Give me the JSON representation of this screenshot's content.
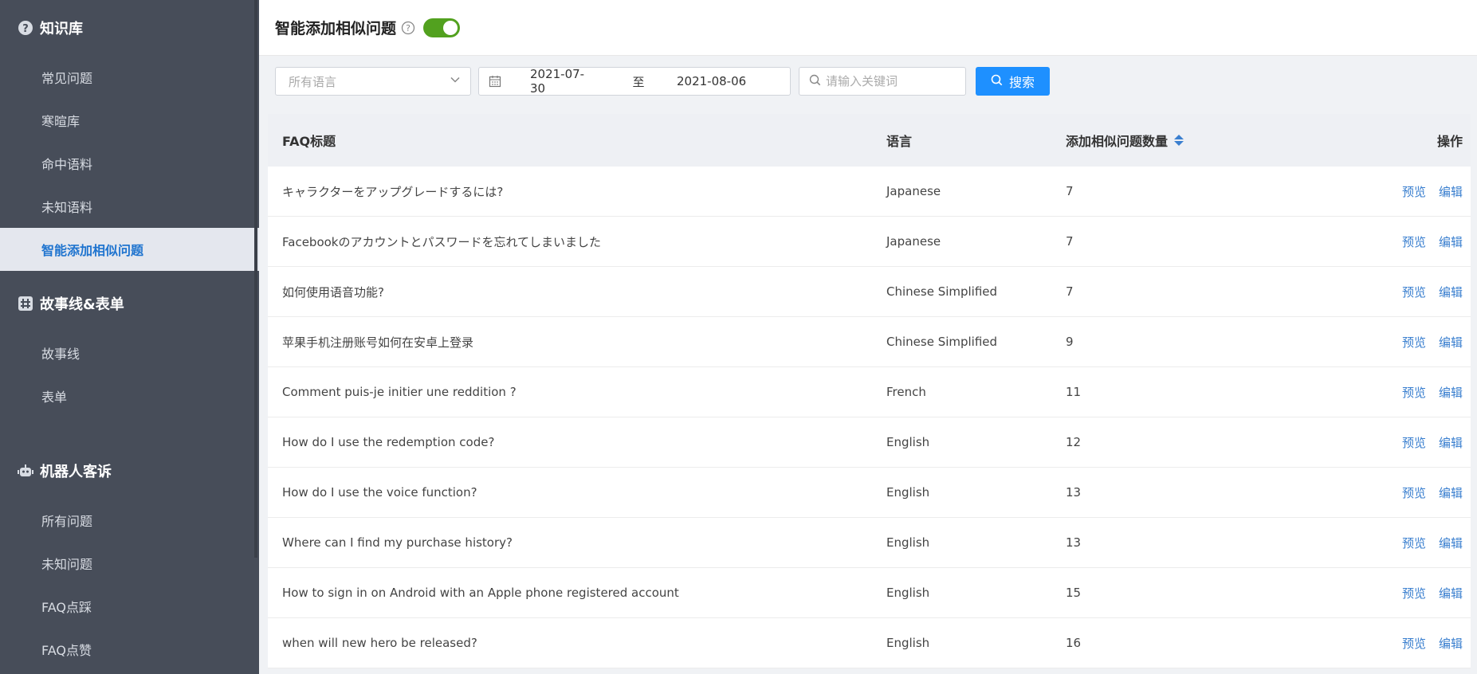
{
  "sidebar": {
    "groups": [
      {
        "label": "知识库",
        "icon": "question-circle-icon"
      },
      {
        "label": "故事线&表单",
        "icon": "hash-grid-icon"
      },
      {
        "label": "机器人客诉",
        "icon": "robot-icon"
      }
    ],
    "kb_items": [
      "常见问题",
      "寒暄库",
      "命中语料",
      "未知语料",
      "智能添加相似问题"
    ],
    "story_items": [
      "故事线",
      "表单"
    ],
    "bot_items": [
      "所有问题",
      "未知问题",
      "FAQ点踩",
      "FAQ点赞"
    ]
  },
  "header": {
    "title": "智能添加相似问题",
    "help_icon": "help-circle-icon",
    "toggle_on": true
  },
  "filters": {
    "language_placeholder": "所有语言",
    "date_start": "2021-07-30",
    "date_sep": "至",
    "date_end": "2021-08-06",
    "keyword_placeholder": "请输入关键词",
    "search_label": "搜索"
  },
  "table": {
    "headers": {
      "title": "FAQ标题",
      "language": "语言",
      "count": "添加相似问题数量",
      "ops": "操作"
    },
    "preview_label": "预览",
    "edit_label": "编辑",
    "rows": [
      {
        "title": "キャラクターをアップグレードするには?",
        "language": "Japanese",
        "count": "7"
      },
      {
        "title": "Facebookのアカウントとパスワードを忘れてしまいました",
        "language": "Japanese",
        "count": "7"
      },
      {
        "title": "如何使用语音功能?",
        "language": "Chinese Simplified",
        "count": "7"
      },
      {
        "title": "苹果手机注册账号如何在安卓上登录",
        "language": "Chinese Simplified",
        "count": "9"
      },
      {
        "title": "Comment puis-je initier une reddition ?",
        "language": "French",
        "count": "11"
      },
      {
        "title": "How do I use the redemption code?",
        "language": "English",
        "count": "12"
      },
      {
        "title": "How do I use the voice function?",
        "language": "English",
        "count": "13"
      },
      {
        "title": "Where can I find my purchase history?",
        "language": "English",
        "count": "13"
      },
      {
        "title": "How to sign in on Android with an Apple phone registered account",
        "language": "English",
        "count": "15"
      },
      {
        "title": "when will new hero be released?",
        "language": "English",
        "count": "16"
      }
    ]
  },
  "colors": {
    "accent": "#1e90ff",
    "toggle": "#52a11f",
    "sidebar": "#474d59",
    "link": "#3a7fcf"
  }
}
